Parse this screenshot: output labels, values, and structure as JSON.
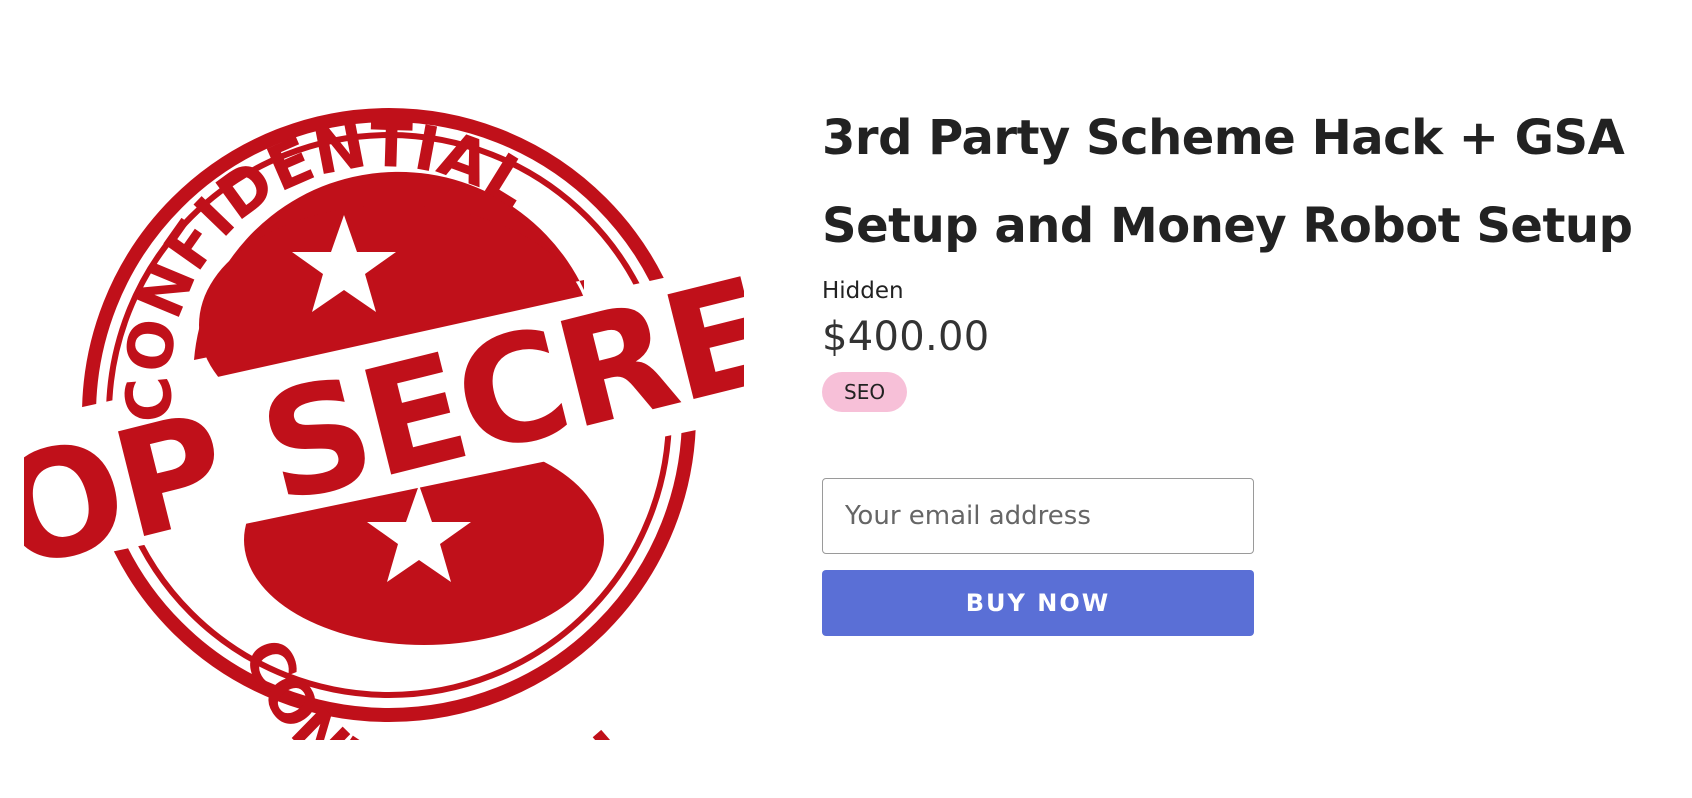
{
  "product": {
    "title": "3rd Party Scheme Hack + GSA Setup and Money Robot Setup",
    "vendor": "Hidden",
    "price": "$400.00",
    "tag": "SEO",
    "image": {
      "stamp_top_text": "CONFIDENTIAL",
      "stamp_main_text": "TOP SECRET",
      "stamp_bottom_text": "CONFIDENTIAL",
      "stamp_color": "#c0101a"
    }
  },
  "form": {
    "email_placeholder": "Your email address",
    "buy_label": "BUY NOW"
  },
  "colors": {
    "button": "#5a6fd6",
    "tag_bg": "#f7c0d8",
    "text": "#222222"
  }
}
